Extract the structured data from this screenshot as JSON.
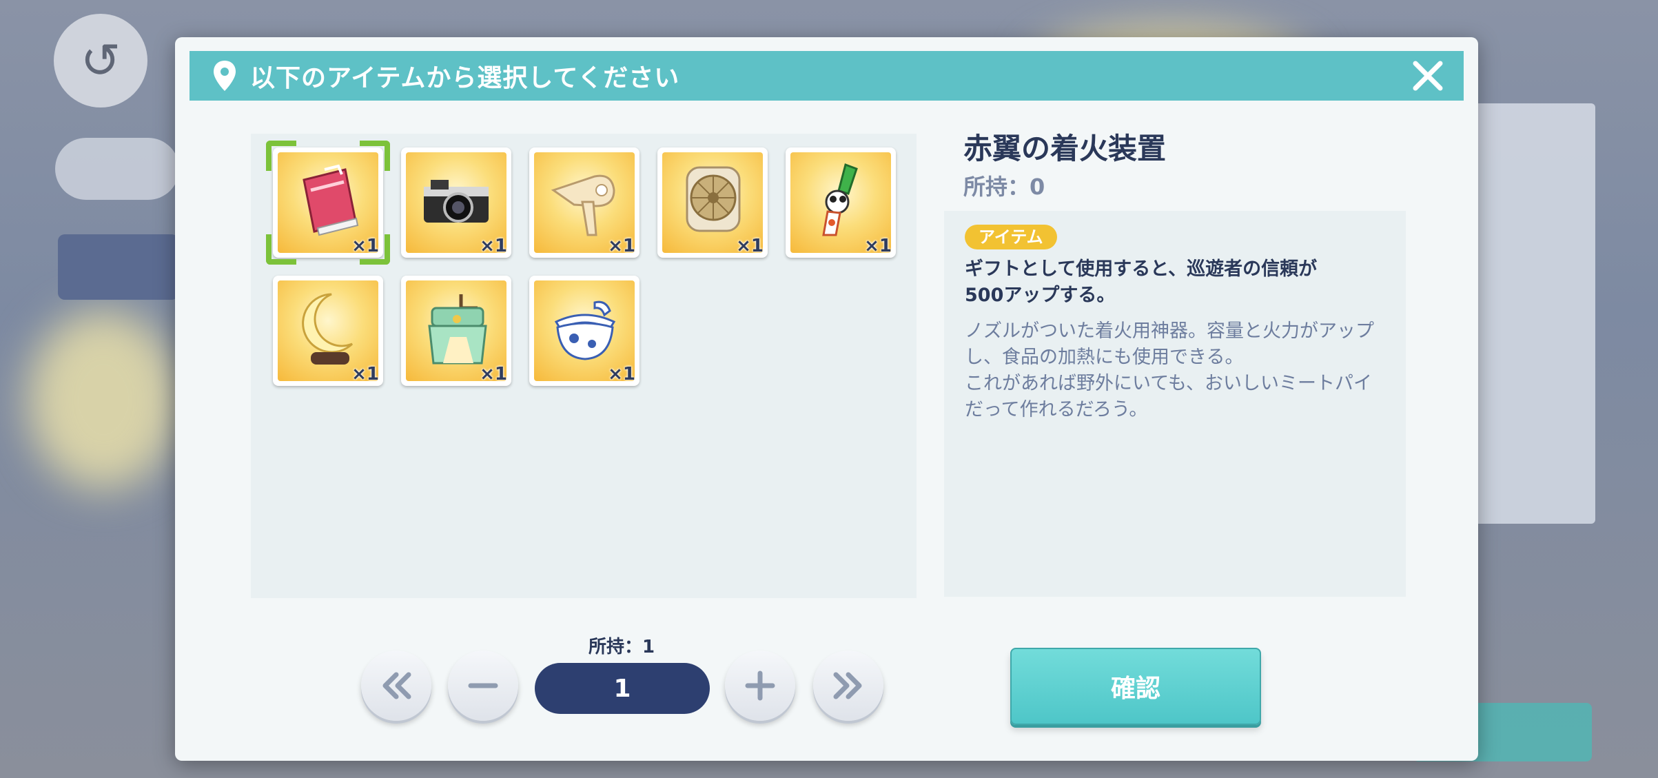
{
  "dialog": {
    "title": "以下のアイテムから選択してください"
  },
  "items": [
    {
      "name": "pink-bag",
      "count": "×1",
      "selected": true
    },
    {
      "name": "camera",
      "count": "×1"
    },
    {
      "name": "hair-dryer",
      "count": "×1"
    },
    {
      "name": "desk-fan",
      "count": "×1"
    },
    {
      "name": "igniter",
      "count": "×1"
    },
    {
      "name": "moon-lamp",
      "count": "×1"
    },
    {
      "name": "grinder",
      "count": "×1"
    },
    {
      "name": "porcelain-bowl",
      "count": "×1"
    }
  ],
  "detail": {
    "name": "赤翼の着火装置",
    "owned": "所持：0",
    "badge": "アイテム",
    "effect_line1": "ギフトとして使用すると、巡遊者の信頼が",
    "effect_line2": "500アップする。",
    "flavor_line1": "ノズルがついた着火用神器。容量と火力がアップ",
    "flavor_line2": "し、食品の加熱にも使用できる。",
    "flavor_line3": "これがあれば野外にいても、おいしいミートパイ",
    "flavor_line4": "だって作れるだろう。"
  },
  "quantity": {
    "owned_label": "所持：1",
    "value": "1"
  },
  "confirm_label": "確認",
  "colors": {
    "header": "#5ec1c6",
    "accent_dark": "#2d3f70",
    "badge": "#f2c232",
    "confirm": "#4ec6c8"
  }
}
